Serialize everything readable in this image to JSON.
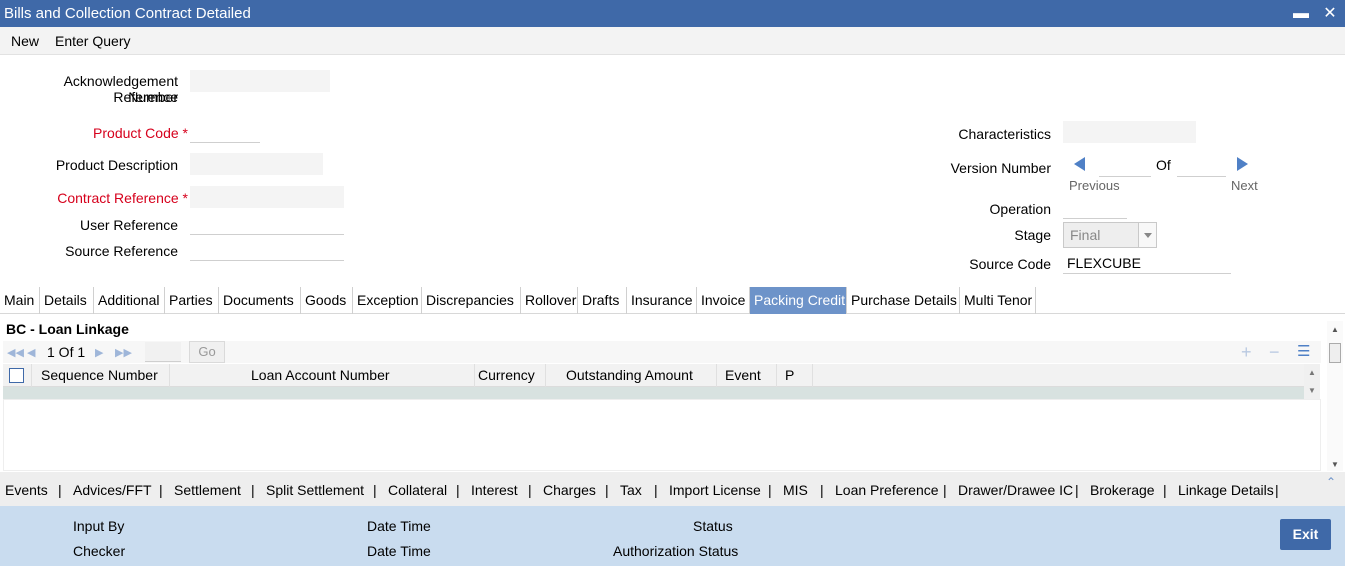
{
  "window": {
    "title": "Bills and Collection Contract Detailed"
  },
  "menu": {
    "new": "New",
    "enter_query": "Enter Query"
  },
  "form": {
    "ack_ref_label_1": "Acknowledgement Reference",
    "ack_ref_label_2": "Number",
    "product_code_label": "Product Code",
    "product_desc_label": "Product Description",
    "contract_ref_label": "Contract Reference",
    "user_ref_label": "User Reference",
    "source_ref_label": "Source Reference",
    "characteristics_label": "Characteristics",
    "version_label": "Version Number",
    "of_label": "Of",
    "previous_label": "Previous",
    "next_label": "Next",
    "operation_label": "Operation",
    "stage_label": "Stage",
    "stage_value": "Final",
    "source_code_label": "Source Code",
    "source_code_value": "FLEXCUBE",
    "required_mark": "*"
  },
  "tabs": [
    "Main",
    "Details",
    "Additional",
    "Parties",
    "Documents",
    "Goods",
    "Exception",
    "Discrepancies",
    "Rollover",
    "Drafts",
    "Insurance",
    "Invoice",
    "Packing Credit",
    "Purchase Details",
    "Multi Tenor"
  ],
  "active_tab": "Packing Credit",
  "section": {
    "title": "BC - Loan Linkage"
  },
  "pager": {
    "text": "1 Of 1",
    "go": "Go"
  },
  "grid": {
    "columns": [
      "Sequence Number",
      "Loan Account Number",
      "Currency",
      "Outstanding Amount",
      "Event",
      "P"
    ]
  },
  "bottom_links": [
    "Events",
    "Advices/FFT",
    "Settlement",
    "Split Settlement",
    "Collateral",
    "Interest",
    "Charges",
    "Tax",
    "Import License",
    "MIS",
    "Loan Preference",
    "Drawer/Drawee IC",
    "Brokerage",
    "Linkage Details"
  ],
  "footer": {
    "input_by": "Input By",
    "checker": "Checker",
    "date_time_1": "Date Time",
    "date_time_2": "Date Time",
    "status": "Status",
    "auth_status": "Authorization Status",
    "exit": "Exit"
  },
  "colors": {
    "titlebar": "#3f69a8",
    "active_tab": "#6d93c9",
    "footer": "#c9dcef",
    "required": "#d6001c"
  }
}
